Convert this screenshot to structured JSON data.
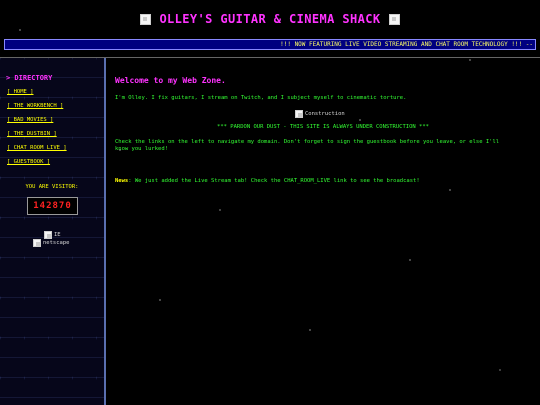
{
  "header": {
    "title": "OLLEY'S GUITAR & CINEMA SHACK",
    "left_icon": "broken-image-icon",
    "right_icon": "broken-image-icon"
  },
  "ticker": {
    "text": "!!! NOW FEATURING LIVE VIDEO STREAMING AND CHAT ROOM TECHNOLOGY !!! --"
  },
  "sidebar": {
    "heading": "> DIRECTORY",
    "items": [
      {
        "label": "[ HOME ]"
      },
      {
        "label": "[ THE_WORKBENCH ]"
      },
      {
        "label": "[ BAD_MOVIES ]"
      },
      {
        "label": "[ THE_DUSTBIN ]"
      },
      {
        "label": "[ CHAT_ROOM_LIVE ]"
      },
      {
        "label": "[ GUESTBOOK ]"
      }
    ],
    "visitor_label": "YOU ARE VISITOR:",
    "visitor_count": "142870",
    "badge_ie": "IE",
    "badge_netscape": "netscape"
  },
  "main": {
    "welcome": "Welcome to my Web Zone.",
    "intro": "I'm Olley. I fix guitars, I stream on Twitch, and I subject myself to cinematic torture.",
    "construction_alt": "Construction",
    "pardon": "*** PARDON OUR DUST - THIS SITE IS ALWAYS UNDER CONSTRUCTION ***",
    "check": "Check the links on the left to navigate my domain. Don't forget to sign the guestbook before you leave, or else I'll know you lurked!",
    "news_label": "News",
    "news_text": ": We just added the Live Stream tab! Check the CHAT_ROOM_LIVE link to see the broadcast!"
  },
  "colors": {
    "background": "#000000",
    "magenta": "#ff33ff",
    "green": "#33ff33",
    "yellow": "#ffff00",
    "ticker_bg": "#000080",
    "counter_red": "#ff2222"
  }
}
